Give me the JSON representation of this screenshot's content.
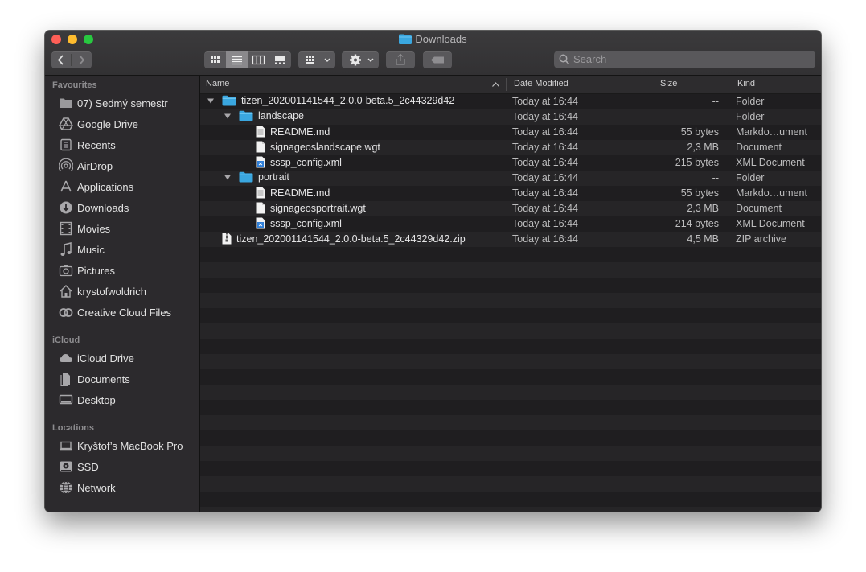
{
  "window": {
    "title": "Downloads"
  },
  "toolbar": {
    "search_placeholder": "Search",
    "view_modes": [
      "icon-view",
      "list-view",
      "column-view",
      "gallery-view"
    ],
    "selected_view": "list-view"
  },
  "sidebar": {
    "sections": [
      {
        "label": "Favourites",
        "items": [
          {
            "label": "07) Sedmý semestr",
            "icon": "folder-icon"
          },
          {
            "label": "Google Drive",
            "icon": "google-drive-icon"
          },
          {
            "label": "Recents",
            "icon": "recents-icon"
          },
          {
            "label": "AirDrop",
            "icon": "airdrop-icon"
          },
          {
            "label": "Applications",
            "icon": "applications-icon"
          },
          {
            "label": "Downloads",
            "icon": "downloads-icon"
          },
          {
            "label": "Movies",
            "icon": "movies-icon"
          },
          {
            "label": "Music",
            "icon": "music-icon"
          },
          {
            "label": "Pictures",
            "icon": "pictures-icon"
          },
          {
            "label": "krystofwoldrich",
            "icon": "home-icon"
          },
          {
            "label": "Creative Cloud Files",
            "icon": "creative-cloud-icon"
          }
        ]
      },
      {
        "label": "iCloud",
        "items": [
          {
            "label": "iCloud Drive",
            "icon": "cloud-icon"
          },
          {
            "label": "Documents",
            "icon": "documents-icon"
          },
          {
            "label": "Desktop",
            "icon": "desktop-icon"
          }
        ]
      },
      {
        "label": "Locations",
        "items": [
          {
            "label": "Kryštof’s MacBook Pro",
            "icon": "laptop-icon"
          },
          {
            "label": "SSD",
            "icon": "disk-icon"
          },
          {
            "label": "Network",
            "icon": "network-icon"
          }
        ]
      }
    ]
  },
  "columns": {
    "name": "Name",
    "date": "Date Modified",
    "size": "Size",
    "kind": "Kind"
  },
  "files": [
    {
      "name": "tizen_202001141544_2.0.0-beta.5_2c44329d42",
      "date": "Today at 16:44",
      "size": "--",
      "kind": "Folder",
      "type": "folder",
      "depth": 0,
      "expanded": true
    },
    {
      "name": "landscape",
      "date": "Today at 16:44",
      "size": "--",
      "kind": "Folder",
      "type": "folder",
      "depth": 1,
      "expanded": true
    },
    {
      "name": "README.md",
      "date": "Today at 16:44",
      "size": "55 bytes",
      "kind": "Markdo…ument",
      "type": "text",
      "depth": 2
    },
    {
      "name": "signageoslandscape.wgt",
      "date": "Today at 16:44",
      "size": "2,3 MB",
      "kind": "Document",
      "type": "doc",
      "depth": 2
    },
    {
      "name": "sssp_config.xml",
      "date": "Today at 16:44",
      "size": "215 bytes",
      "kind": "XML Document",
      "type": "xml",
      "depth": 2
    },
    {
      "name": "portrait",
      "date": "Today at 16:44",
      "size": "--",
      "kind": "Folder",
      "type": "folder",
      "depth": 1,
      "expanded": true
    },
    {
      "name": "README.md",
      "date": "Today at 16:44",
      "size": "55 bytes",
      "kind": "Markdo…ument",
      "type": "text",
      "depth": 2
    },
    {
      "name": "signageosportrait.wgt",
      "date": "Today at 16:44",
      "size": "2,3 MB",
      "kind": "Document",
      "type": "doc",
      "depth": 2
    },
    {
      "name": "sssp_config.xml",
      "date": "Today at 16:44",
      "size": "214 bytes",
      "kind": "XML Document",
      "type": "xml",
      "depth": 2
    },
    {
      "name": "tizen_202001141544_2.0.0-beta.5_2c44329d42.zip",
      "date": "Today at 16:44",
      "size": "4,5 MB",
      "kind": "ZIP archive",
      "type": "zip",
      "depth": 0
    }
  ],
  "colors": {
    "folder": "#3aa7e0",
    "accent": "#3b88f5"
  }
}
